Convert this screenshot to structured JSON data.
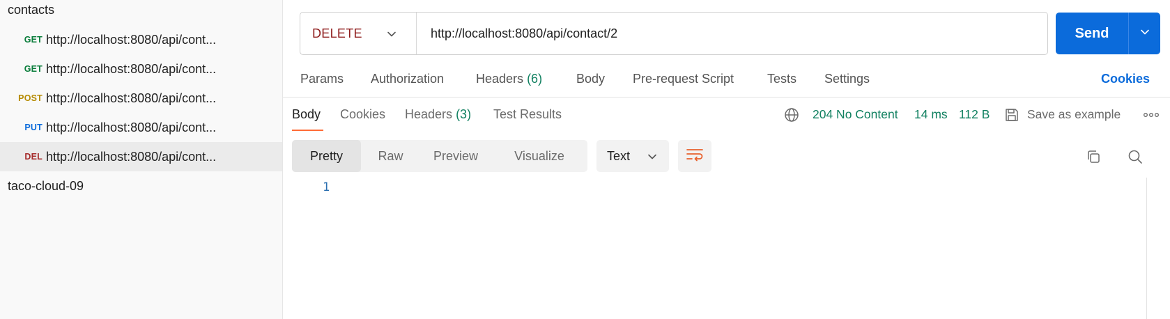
{
  "sidebar": {
    "collections": [
      {
        "name": "contacts"
      },
      {
        "name": "taco-cloud-09"
      }
    ],
    "requests": [
      {
        "method": "GET",
        "method_color": "#0a7d3b",
        "url": "http://localhost:8080/api/cont..."
      },
      {
        "method": "GET",
        "method_color": "#0a7d3b",
        "url": "http://localhost:8080/api/cont..."
      },
      {
        "method": "POST",
        "method_color": "#b58a00",
        "url": "http://localhost:8080/api/cont..."
      },
      {
        "method": "PUT",
        "method_color": "#0b6bdb",
        "url": "http://localhost:8080/api/cont..."
      },
      {
        "method": "DEL",
        "method_color": "#a52a2a",
        "url": "http://localhost:8080/api/cont...",
        "active": true
      }
    ]
  },
  "request": {
    "method": "DELETE",
    "url": "http://localhost:8080/api/contact/2",
    "send_label": "Send"
  },
  "request_tabs": {
    "params": "Params",
    "authorization": "Authorization",
    "headers": "Headers",
    "headers_count": "(6)",
    "body": "Body",
    "prerequest": "Pre-request Script",
    "tests": "Tests",
    "settings": "Settings",
    "cookies": "Cookies"
  },
  "response_tabs": {
    "body": "Body",
    "cookies": "Cookies",
    "headers": "Headers",
    "headers_count": "(3)",
    "test_results": "Test Results"
  },
  "response_status": {
    "status": "204 No Content",
    "time": "14 ms",
    "size": "112 B",
    "save_label": "Save as example"
  },
  "body_view": {
    "modes": [
      "Pretty",
      "Raw",
      "Preview",
      "Visualize"
    ],
    "active_mode": "Pretty",
    "format": "Text"
  },
  "editor": {
    "line_numbers": [
      "1"
    ]
  },
  "colors": {
    "accent": "#0b6bdb",
    "tab_underline": "#ff6c37",
    "status_green": "#108060",
    "delete_method": "#8f1d1d"
  },
  "icons": {
    "method_dropdown": "chevron-down-icon",
    "send_dropdown": "chevron-down-icon",
    "network": "globe-icon",
    "save": "save-icon",
    "more": "more-horizontal-icon",
    "format_dropdown": "chevron-down-icon",
    "wrap": "wrap-lines-icon",
    "copy": "copy-icon",
    "search": "search-icon"
  }
}
